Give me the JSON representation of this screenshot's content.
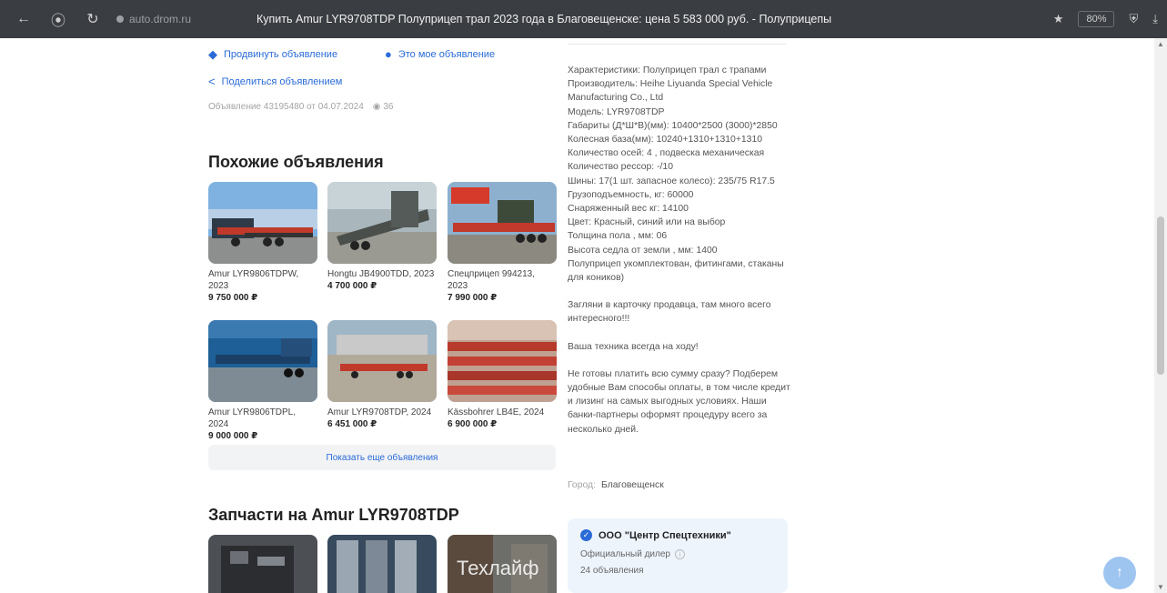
{
  "browser": {
    "back_icon": "←",
    "shield_icon": "⦿",
    "reload_icon": "↻",
    "site": "auto.drom.ru",
    "title": "Купить Amur LYR9708TDP Полуприцеп трал 2023 года в Благовещенске: цена 5 583 000 руб. - Полуприцепы",
    "zoom": "80%"
  },
  "actions": {
    "promote": "Продвинуть объявление",
    "mine": "Это мое объявление",
    "share": "Поделиться объявлением",
    "meta_text": "Объявление 43195480 от 04.07.2024",
    "views": "36"
  },
  "similar": {
    "title": "Похожие объявления",
    "items": [
      {
        "name": "Amur LYR9806TDPW, 2023",
        "price": "9 750 000 ₽"
      },
      {
        "name": "Hongtu JB4900TDD, 2023",
        "price": "4 700 000 ₽"
      },
      {
        "name": "Спецприцеп 994213, 2023",
        "price": "7 990 000 ₽"
      },
      {
        "name": "Amur LYR9806TDPL, 2024",
        "price": "9 000 000 ₽"
      },
      {
        "name": "Amur LYR9708TDP, 2024",
        "price": "6 451 000 ₽"
      },
      {
        "name": "Kässbohrer LB4E, 2024",
        "price": "6 900 000 ₽"
      }
    ],
    "show_more": "Показать еще объявления"
  },
  "parts": {
    "title": "Запчасти на Amur LYR9708TDP",
    "watermark": "Техлайф"
  },
  "description": {
    "lines": [
      "Характеристики: Полуприцеп трал с трапами",
      "Производитель: Heihe Liyuanda Special Vehicle Manufacturing Co., Ltd",
      "Модель: LYR9708TDP",
      "Габариты (Д*Ш*В)(мм): 10400*2500 (3000)*2850",
      "Колесная база(мм): 10240+1310+1310+1310",
      "Количество осей: 4 , подвеска механическая",
      "Количество рессор: -/10",
      "Шины: 17(1 шт. запасное колесо): 235/75 R17.5",
      "Грузоподъемность, кг: 60000",
      "Снаряженный вес кг: 14100",
      "Цвет: Красный, синий или на выбор",
      "Толщина пола , мм: 06",
      "Высота седла от земли , мм: 1400",
      "Полуприцеп укомплектован, фитингами, стаканы для коников)"
    ],
    "paragraphs": [
      "Загляни в карточку продавца, там много всего интересного!!!",
      "Ваша техника всегда на ходу!",
      "Не готовы платить всю сумму сразу? Подберем удобные Вам способы оплаты, в том числе кредит и лизинг на самых выгодных условиях. Наши банки-партнеры оформят процедуру всего за несколько дней."
    ],
    "city_label": "Город:",
    "city": "Благовещенск"
  },
  "dealer": {
    "name": "ООО \"Центр Спецтехники\"",
    "type": "Официальный дилер",
    "count": "24 объявления"
  },
  "colors": {
    "accent": "#2a6bd6",
    "browser_bar": "#3a3d41"
  }
}
